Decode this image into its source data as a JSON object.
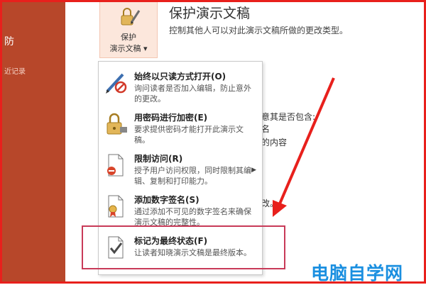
{
  "sidebar": {
    "items": [
      {
        "label": "防",
        "type": "main"
      },
      {
        "label": "近记录",
        "type": "sub"
      }
    ]
  },
  "protect_button": {
    "line1": "保护",
    "line2": "演示文稿",
    "caret": "▾",
    "icon": "lock-pen-icon"
  },
  "section": {
    "title": "保护演示文稿",
    "description": "控制其他人可以对此演示文稿所做的更改类型。"
  },
  "background_fragments": {
    "check_line": "意其是否包含:",
    "line2": "名",
    "line3": "的内容",
    "line4": "改。"
  },
  "menu": {
    "items": [
      {
        "title": "始终以只读方式打开(O)",
        "description": "询问读者是否加入编辑，防止意外的更改。",
        "icon": "read-only-pen-icon",
        "submenu": false
      },
      {
        "title": "用密码进行加密(E)",
        "description": "要求提供密码才能打开此演示文稿。",
        "icon": "password-lock-icon",
        "submenu": false
      },
      {
        "title": "限制访问(R)",
        "description": "授予用户访问权限，同时限制其编辑、复制和打印能力。",
        "icon": "restrict-access-icon",
        "submenu": true,
        "arrow": "▶"
      },
      {
        "title": "添加数字签名(S)",
        "description": "通过添加不可见的数字签名来确保演示文稿的完整性。",
        "icon": "digital-signature-icon",
        "submenu": false
      },
      {
        "title": "标记为最终状态(F)",
        "description": "让读者知晓演示文稿是最终版本。",
        "icon": "mark-final-icon",
        "submenu": false
      }
    ]
  },
  "watermark": "电脑自学网",
  "colors": {
    "sidebar": "#b7472a",
    "protect_button_bg": "#fce7dc",
    "highlight": "#c83a58",
    "arrow": "#e8201c",
    "watermark": "#1a8fe0"
  }
}
